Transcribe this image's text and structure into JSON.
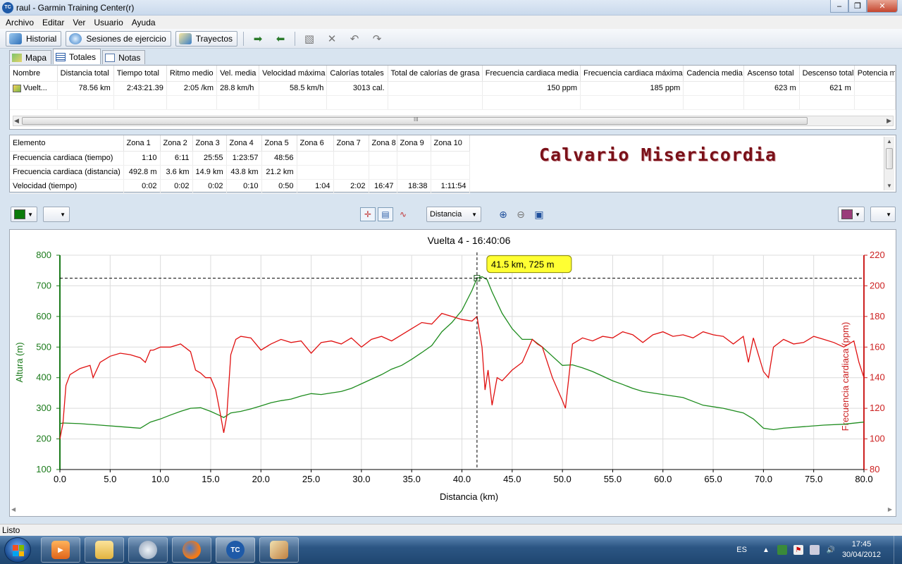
{
  "window": {
    "title": "raul - Garmin Training Center(r)",
    "app_icon_text": "TC"
  },
  "menu": [
    "Archivo",
    "Editar",
    "Ver",
    "Usuario",
    "Ayuda"
  ],
  "toolbar": {
    "historial": "Historial",
    "sesiones": "Sesiones de ejercicio",
    "trayectos": "Trayectos"
  },
  "tabs": [
    "Mapa",
    "Totales",
    "Notas"
  ],
  "totals_table": {
    "headers": [
      "Nombre",
      "Distancia total",
      "Tiempo total",
      "Ritmo medio",
      "Vel. media",
      "Velocidad máxima",
      "Calorías totales",
      "Total de calorías de grasa",
      "Frecuencia cardiaca media",
      "Frecuencia cardiaca máxima",
      "Cadencia media",
      "Ascenso total",
      "Descenso total",
      "Potencia m"
    ],
    "row": [
      "Vuelt...",
      "78.56 km",
      "2:43:21.39",
      "2:05 /km",
      "28.8 km/h",
      "58.5 km/h",
      "3013 cal.",
      "",
      "150 ppm",
      "185 ppm",
      "",
      "623 m",
      "621 m",
      ""
    ],
    "scroll_grip": "III"
  },
  "zones_table": {
    "headers": [
      "Elemento",
      "Zona 1",
      "Zona 2",
      "Zona 3",
      "Zona 4",
      "Zona 5",
      "Zona 6",
      "Zona 7",
      "Zona 8",
      "Zona 9",
      "Zona 10"
    ],
    "rows": [
      [
        "Frecuencia cardiaca (tiempo)",
        "1:10",
        "6:11",
        "25:55",
        "1:23:57",
        "48:56",
        "",
        "",
        "",
        "",
        ""
      ],
      [
        "Frecuencia cardiaca (distancia)",
        "492.8 m",
        "3.6 km",
        "14.9 km",
        "43.8 km",
        "21.2 km",
        "",
        "",
        "",
        "",
        ""
      ],
      [
        "Velocidad (tiempo)",
        "0:02",
        "0:02",
        "0:02",
        "0:10",
        "0:50",
        "1:04",
        "2:02",
        "16:47",
        "18:38",
        "1:11:54"
      ]
    ]
  },
  "overlay_title": "Calvario Misericordia",
  "chart_toolbar": {
    "left_color": "#0a7a0a",
    "right_color": "#9a3c7a",
    "x_mode": "Distancia"
  },
  "status": "Listo",
  "taskbar": {
    "lang": "ES",
    "time": "17:45",
    "date": "30/04/2012"
  },
  "chart_data": {
    "type": "line",
    "title": "Vuelta 4 - 16:40:06",
    "xlabel": "Distancia (km)",
    "ylabel_left": "Altura (m)",
    "ylabel_right": "Frecuencia cardiaca (ppm)",
    "xlim": [
      0,
      80
    ],
    "ylim_left": [
      100,
      800
    ],
    "ylim_right": [
      80,
      220
    ],
    "x_ticks": [
      "0.0",
      "5.0",
      "10.0",
      "15.0",
      "20.0",
      "25.0",
      "30.0",
      "35.0",
      "40.0",
      "45.0",
      "50.0",
      "55.0",
      "60.0",
      "65.0",
      "70.0",
      "75.0",
      "80.0"
    ],
    "y_left_ticks": [
      "100",
      "200",
      "300",
      "400",
      "500",
      "600",
      "700",
      "800"
    ],
    "y_right_ticks": [
      "80",
      "100",
      "120",
      "140",
      "160",
      "180",
      "200",
      "220"
    ],
    "grid": true,
    "cursor_label": "41.5 km, 725 m",
    "cursor": {
      "x": 41.5,
      "y": 725
    },
    "colors": {
      "altitude": "#1e8c1e",
      "heart_rate": "#e01010",
      "axis_left": "#1a7a1a",
      "axis_right": "#cc2020"
    },
    "series": [
      {
        "name": "Altura",
        "axis": "left",
        "x": [
          0,
          0.3,
          2,
          4,
          6,
          8,
          9,
          10,
          11,
          12,
          13,
          14,
          15,
          15.8,
          16.3,
          17,
          18,
          19,
          20,
          21,
          22,
          23,
          24,
          25,
          26,
          27,
          28,
          29,
          30,
          31,
          32,
          33,
          34,
          35,
          36,
          37,
          38,
          39,
          40,
          41,
          41.5,
          42,
          42.5,
          43,
          44,
          45,
          46,
          47,
          48,
          49,
          50,
          51,
          52,
          53,
          54,
          55,
          56,
          57,
          58,
          60,
          62,
          64,
          66,
          68,
          69,
          70,
          71,
          72,
          74,
          76,
          78,
          80
        ],
        "values": [
          250,
          252,
          250,
          245,
          240,
          235,
          255,
          265,
          278,
          290,
          300,
          302,
          290,
          278,
          270,
          285,
          290,
          298,
          308,
          318,
          325,
          330,
          340,
          348,
          345,
          350,
          355,
          365,
          380,
          395,
          410,
          428,
          440,
          460,
          482,
          505,
          550,
          580,
          620,
          685,
          725,
          730,
          720,
          680,
          610,
          560,
          525,
          525,
          500,
          470,
          440,
          442,
          432,
          420,
          405,
          390,
          378,
          365,
          355,
          345,
          335,
          310,
          300,
          285,
          265,
          235,
          230,
          235,
          240,
          245,
          248,
          255
        ]
      },
      {
        "name": "Frecuencia cardiaca",
        "axis": "right",
        "x": [
          0,
          0.3,
          0.6,
          1,
          2,
          3,
          3.3,
          4,
          5,
          6,
          7,
          8,
          8.5,
          9,
          9.3,
          10,
          11,
          12,
          13,
          13.5,
          14,
          14.5,
          15,
          15.5,
          16,
          16.3,
          16.6,
          17,
          17.5,
          18,
          19,
          20,
          21,
          22,
          23,
          24,
          25,
          26,
          27,
          28,
          29,
          30,
          31,
          32,
          33,
          34,
          35,
          36,
          37,
          38,
          39,
          40,
          41,
          41.5,
          42,
          42.3,
          42.6,
          43,
          43.5,
          44,
          45,
          46,
          47,
          47.5,
          48,
          49,
          50,
          50.3,
          51,
          52,
          53,
          54,
          55,
          56,
          57,
          58,
          59,
          60,
          61,
          62,
          63,
          64,
          65,
          66,
          67,
          68,
          68.5,
          69,
          70,
          70.5,
          71,
          72,
          73,
          74,
          75,
          76,
          77,
          78,
          79,
          79.5,
          80
        ],
        "values": [
          100,
          110,
          135,
          142,
          146,
          148,
          140,
          150,
          154,
          156,
          155,
          153,
          150,
          158,
          158,
          160,
          160,
          162,
          157,
          145,
          143,
          140,
          140,
          132,
          115,
          104,
          115,
          155,
          165,
          167,
          166,
          158,
          162,
          165,
          163,
          164,
          156,
          163,
          164,
          162,
          166,
          160,
          165,
          167,
          164,
          168,
          172,
          176,
          175,
          182,
          180,
          178,
          177,
          180,
          160,
          132,
          145,
          122,
          140,
          138,
          145,
          150,
          165,
          162,
          160,
          140,
          125,
          120,
          162,
          166,
          164,
          167,
          166,
          170,
          168,
          163,
          168,
          170,
          167,
          168,
          166,
          170,
          168,
          167,
          162,
          167,
          150,
          166,
          144,
          140,
          160,
          165,
          162,
          163,
          167,
          165,
          163,
          160,
          164,
          150,
          140
        ]
      }
    ]
  }
}
